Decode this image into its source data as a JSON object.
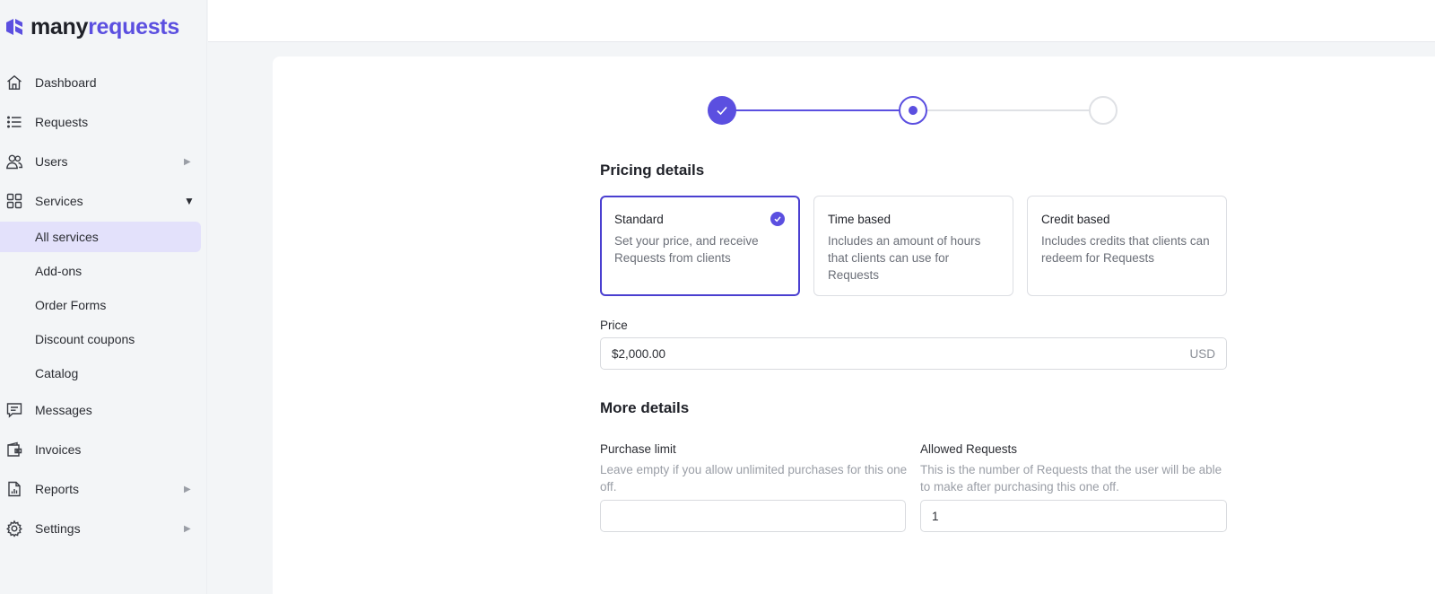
{
  "brand": {
    "name_part1": "many",
    "name_part2": "requests",
    "accent_color": "#5b4fe0"
  },
  "sidebar": {
    "items": [
      {
        "label": "Dashboard",
        "icon": "home-icon"
      },
      {
        "label": "Requests",
        "icon": "list-icon"
      },
      {
        "label": "Users",
        "icon": "users-icon",
        "caret": "▶"
      },
      {
        "label": "Services",
        "icon": "grid-icon",
        "caret": "▼"
      },
      {
        "label": "Messages",
        "icon": "message-icon"
      },
      {
        "label": "Invoices",
        "icon": "wallet-icon"
      },
      {
        "label": "Reports",
        "icon": "report-icon",
        "caret": "▶"
      },
      {
        "label": "Settings",
        "icon": "gear-icon",
        "caret": "▶"
      }
    ],
    "services_sub": [
      {
        "label": "All services",
        "active": true
      },
      {
        "label": "Add-ons"
      },
      {
        "label": "Order Forms"
      },
      {
        "label": "Discount coupons"
      },
      {
        "label": "Catalog"
      }
    ]
  },
  "stepper": {
    "steps": [
      "done",
      "current",
      "todo"
    ]
  },
  "pricing": {
    "title": "Pricing details",
    "options": [
      {
        "title": "Standard",
        "desc": "Set your price, and receive Requests from clients",
        "selected": true
      },
      {
        "title": "Time based",
        "desc": "Includes an amount of hours that clients can use for Requests"
      },
      {
        "title": "Credit based",
        "desc": "Includes credits that clients can redeem for Requests"
      }
    ],
    "price_label": "Price",
    "price_value": "$2,000.00",
    "price_currency": "USD"
  },
  "more_details": {
    "title": "More details",
    "purchase_limit": {
      "label": "Purchase limit",
      "help": "Leave empty if you allow unlimited purchases for this one off.",
      "value": ""
    },
    "allowed_requests": {
      "label": "Allowed Requests",
      "help": "This is the number of Requests that the user will be able to make after purchasing this one off.",
      "value": "1"
    }
  }
}
